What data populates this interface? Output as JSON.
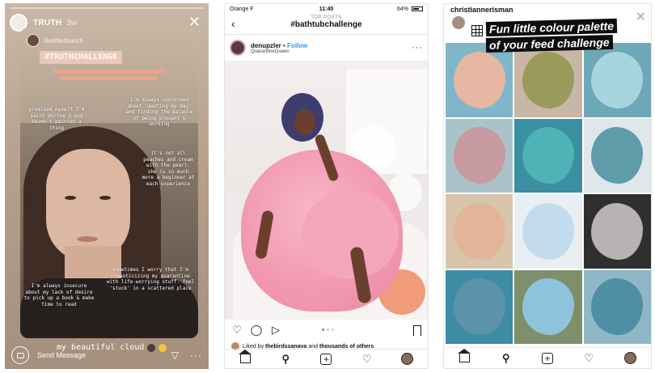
{
  "story": {
    "username": "TRUTH",
    "time": "3w",
    "inner_username": "lilsettlerbunch",
    "hashtag": "#TRUTHCHALLENGE",
    "notes": [
      "promised myself I'd paint during Q and haven't painted a thing",
      "I'm always concerned about 'wasting my day' and finding the balance of being present & working",
      "it's not all peaches and cream with the pearl. she is so much more a beginner at each experience",
      "sometimes I worry that I'm romanticizing my quarantine with life-worrying stuff. feel 'stuck' in a scattered place",
      "I'm always insecure about my lack of desire to pick up a book & make time to read"
    ],
    "caption": "my beautiful cloud",
    "reply_placeholder": "Send Message",
    "icons": {
      "camera": "camera-icon",
      "send": "direct-send-icon",
      "more": "more-icon",
      "close": "close-icon"
    }
  },
  "post": {
    "status": {
      "carrier": "Orange F",
      "time": "11:40",
      "battery": "64%"
    },
    "nav_subtitle": "TOP POSTS",
    "nav_title": "#bathtubchallenge",
    "username": "denupzler",
    "follow": "Follow",
    "location": "QuarantineQueen",
    "liked_prefix": "Liked by",
    "liked_user": "thebirdssanava",
    "liked_suffix": "and",
    "liked_others": "thousands of others",
    "colors": {
      "link": "#3897f0",
      "dress": "#f29ab2"
    }
  },
  "grid": {
    "username": "christiannerisman",
    "title_line1": "Fun little colour palette",
    "title_line2": "of your feed challenge",
    "swatches": [
      "#e6b7a2",
      "#9a9a5c",
      "#a6d4df",
      "#c89aa2",
      "#4fb2b7",
      "#5f9ca9",
      "#e2b59b",
      "#c2dced",
      "#b8b2b2",
      "#5b93aa",
      "#8fc2db",
      "#4e8fa4"
    ],
    "backgrounds": [
      "#7fb6c9",
      "#c8b7a5",
      "#6ea8b8",
      "#a9c3c8",
      "#3a8fa0",
      "#dfe7ea",
      "#d9c4ac",
      "#e8eef2",
      "#2f2f2f",
      "#3c8da3",
      "#7e8f6c",
      "#8fb7c6"
    ]
  }
}
